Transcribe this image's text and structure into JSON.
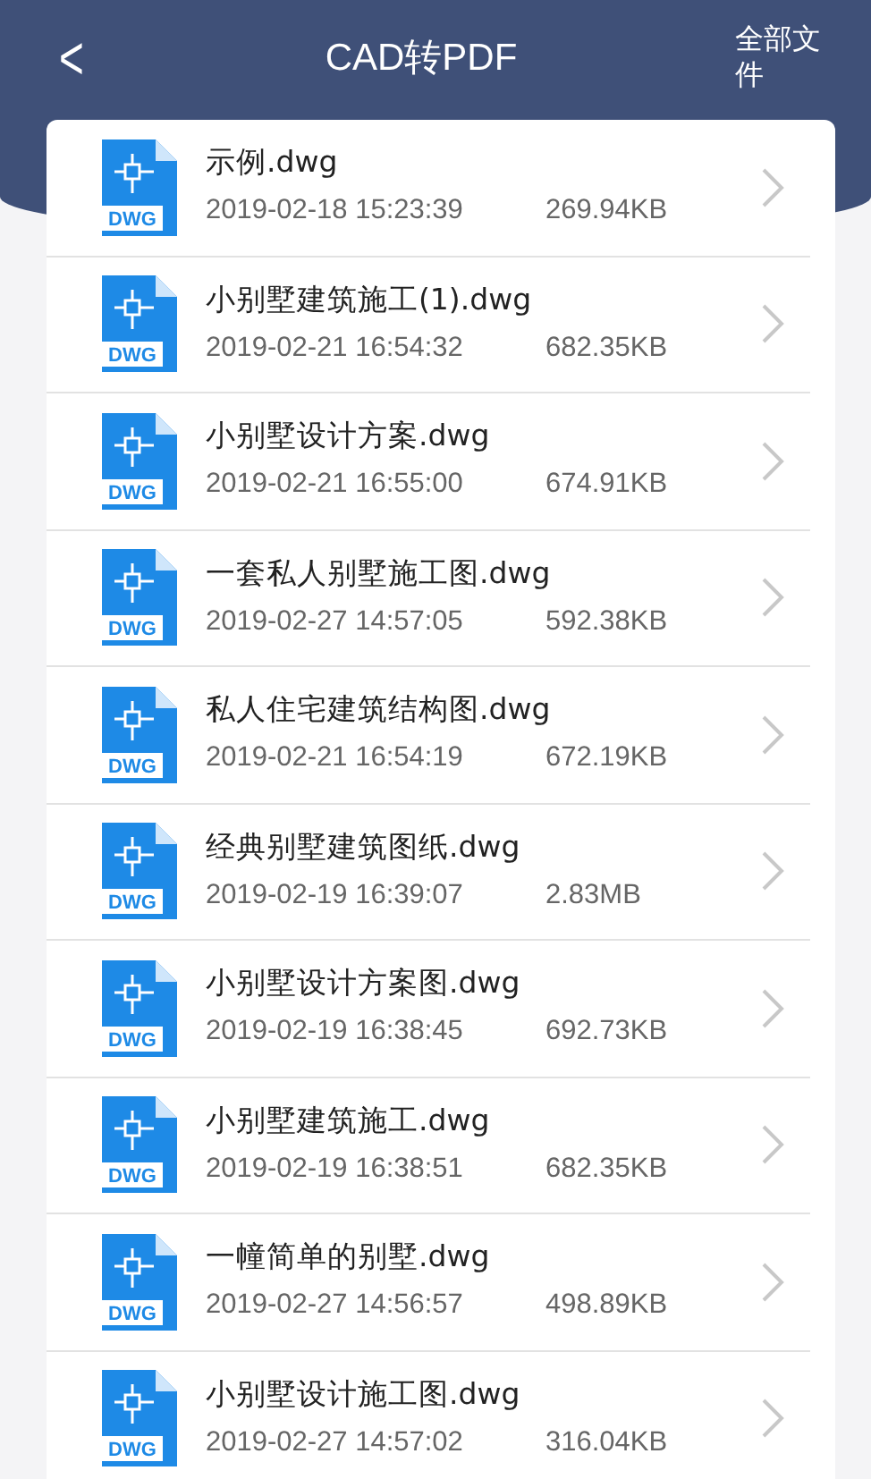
{
  "header": {
    "back": "<",
    "title": "CAD转PDF",
    "action": "全部文件"
  },
  "files": [
    {
      "name": "示例.dwg",
      "date": "2019-02-18 15:23:39",
      "size": "269.94KB",
      "icon_label": "DWG"
    },
    {
      "name": "小别墅建筑施工(1).dwg",
      "date": "2019-02-21 16:54:32",
      "size": "682.35KB",
      "icon_label": "DWG"
    },
    {
      "name": "小别墅设计方案.dwg",
      "date": "2019-02-21 16:55:00",
      "size": "674.91KB",
      "icon_label": "DWG"
    },
    {
      "name": "一套私人别墅施工图.dwg",
      "date": "2019-02-27 14:57:05",
      "size": "592.38KB",
      "icon_label": "DWG"
    },
    {
      "name": "私人住宅建筑结构图.dwg",
      "date": "2019-02-21 16:54:19",
      "size": "672.19KB",
      "icon_label": "DWG"
    },
    {
      "name": "经典别墅建筑图纸.dwg",
      "date": "2019-02-19 16:39:07",
      "size": "2.83MB",
      "icon_label": "DWG"
    },
    {
      "name": "小别墅设计方案图.dwg",
      "date": "2019-02-19 16:38:45",
      "size": "692.73KB",
      "icon_label": "DWG"
    },
    {
      "name": "小别墅建筑施工.dwg",
      "date": "2019-02-19 16:38:51",
      "size": "682.35KB",
      "icon_label": "DWG"
    },
    {
      "name": "一幢简单的别墅.dwg",
      "date": "2019-02-27 14:56:57",
      "size": "498.89KB",
      "icon_label": "DWG"
    },
    {
      "name": "小别墅设计施工图.dwg",
      "date": "2019-02-27 14:57:02",
      "size": "316.04KB",
      "icon_label": "DWG"
    }
  ]
}
